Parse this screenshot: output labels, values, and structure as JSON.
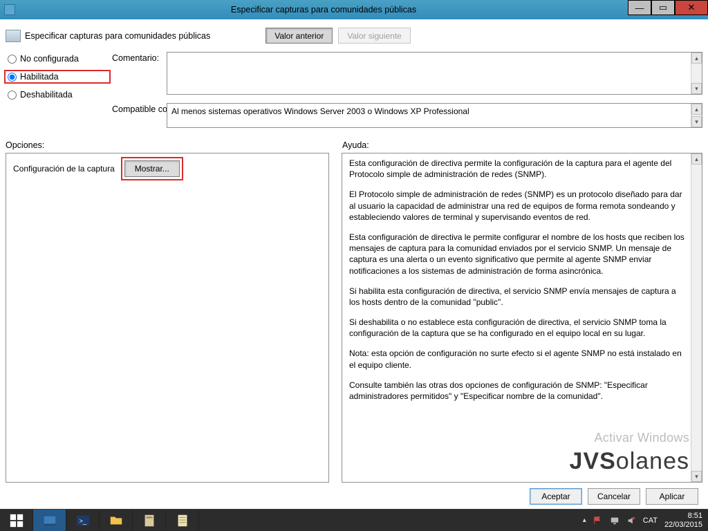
{
  "window": {
    "title": "Especificar capturas para comunidades públicas"
  },
  "header": {
    "title": "Especificar capturas para comunidades públicas",
    "prev_btn": "Valor anterior",
    "next_btn": "Valor siguiente"
  },
  "state": {
    "options": [
      {
        "label": "No configurada",
        "checked": false
      },
      {
        "label": "Habilitada",
        "checked": true
      },
      {
        "label": "Deshabilitada",
        "checked": false
      }
    ]
  },
  "labels": {
    "comment": "Comentario:",
    "compat": "Compatible con:",
    "options": "Opciones:",
    "help": "Ayuda:"
  },
  "compat_text": "Al menos sistemas operativos Windows Server 2003 o Windows XP Professional",
  "options_panel": {
    "row_label": "Configuración de la captura",
    "show_btn": "Mostrar..."
  },
  "help": {
    "p1": "Esta configuración de directiva permite la configuración de la captura para el agente del Protocolo simple de administración de redes (SNMP).",
    "p2": "El Protocolo simple de administración de redes (SNMP) es un protocolo diseñado para dar al usuario la capacidad de administrar una red de equipos de forma remota sondeando y estableciendo valores de terminal y supervisando eventos de red.",
    "p3": "Esta configuración de directiva le permite configurar el nombre de los hosts que reciben los mensajes de captura para la comunidad enviados por el servicio SNMP. Un mensaje de captura es una alerta o un evento significativo que permite al agente SNMP enviar notificaciones a los sistemas de administración de forma asincrónica.",
    "p4": "Si habilita esta configuración de directiva, el servicio SNMP envía mensajes de captura a los hosts dentro de la comunidad \"public\".",
    "p5": "Si deshabilita o no establece esta configuración de directiva, el servicio SNMP toma la configuración de la captura que se ha configurado en el equipo local en su lugar.",
    "p6": "Nota: esta opción de configuración no surte efecto si el agente SNMP no está instalado en el equipo cliente.",
    "p7": "Consulte también las otras dos opciones de configuración de SNMP: \"Especificar administradores permitidos\" y \"Especificar nombre de la comunidad\"."
  },
  "watermark": {
    "line1": "Activar Windows",
    "logo_a": "JVS",
    "logo_b": "olanes"
  },
  "dialog_buttons": {
    "ok": "Aceptar",
    "cancel": "Cancelar",
    "apply": "Aplicar"
  },
  "taskbar": {
    "lang": "CAT",
    "time": "8:51",
    "date": "22/03/2015"
  }
}
